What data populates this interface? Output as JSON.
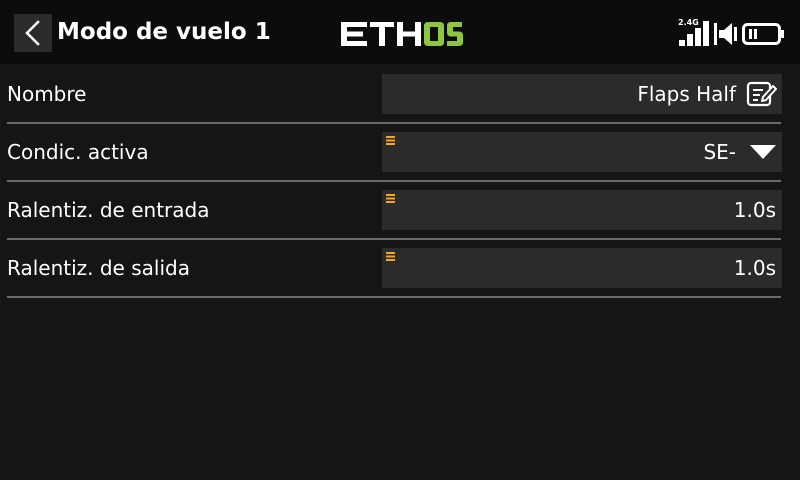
{
  "header": {
    "title": "Modo de vuelo 1",
    "logo_text": "ETHOS",
    "logo_colors": {
      "main": "#ffffff",
      "accent": "#8ec63f"
    },
    "signal_band": "2.4G"
  },
  "rows": [
    {
      "label": "Nombre",
      "value": "Flaps Half",
      "icon": "edit-icon"
    },
    {
      "label": "Condic. activa",
      "value": "SE-",
      "icon": "dropdown-arrow-icon"
    },
    {
      "label": "Ralentiz. de entrada",
      "value": "1.0s"
    },
    {
      "label": "Ralentiz. de salida",
      "value": "1.0s"
    }
  ],
  "colors": {
    "background": "#151515",
    "field": "#2b2b2b",
    "divider": "#6a6a6a",
    "marker": "#f5a623"
  }
}
